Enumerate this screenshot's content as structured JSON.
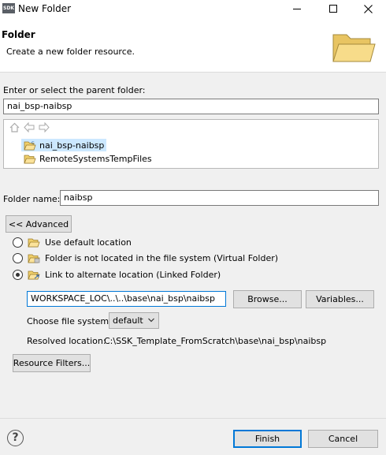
{
  "window": {
    "app_badge": "SDK",
    "title": "New Folder"
  },
  "header": {
    "title": "Folder",
    "description": "Create a new folder resource."
  },
  "parent": {
    "label": "Enter or select the parent folder:",
    "value": "nai_bsp-naibsp"
  },
  "tree": {
    "items": [
      {
        "label": "nai_bsp-naibsp",
        "selected": true
      },
      {
        "label": "RemoteSystemsTempFiles",
        "selected": false
      }
    ]
  },
  "folder_name": {
    "label": "Folder name:",
    "value": "naibsp"
  },
  "advanced_button": "<< Advanced",
  "location_options": [
    {
      "label": "Use default location",
      "checked": false
    },
    {
      "label": "Folder is not located in the file system (Virtual Folder)",
      "checked": false
    },
    {
      "label": "Link to alternate location (Linked Folder)",
      "checked": true
    }
  ],
  "link": {
    "path_value": "WORKSPACE_LOC\\..\\..\\base\\nai_bsp\\naibsp",
    "browse_label": "Browse...",
    "variables_label": "Variables...",
    "file_system_label": "Choose file system:",
    "file_system_value": "default",
    "resolved_label": "Resolved location:",
    "resolved_value": "C:\\SSK_Template_FromScratch\\base\\nai_bsp\\naibsp"
  },
  "resource_filters_label": "Resource Filters...",
  "footer": {
    "finish_label": "Finish",
    "cancel_label": "Cancel"
  },
  "colors": {
    "selection": "#cce8ff",
    "focus_accent": "#0078d7",
    "folder_yellow": "#f5d77a"
  }
}
